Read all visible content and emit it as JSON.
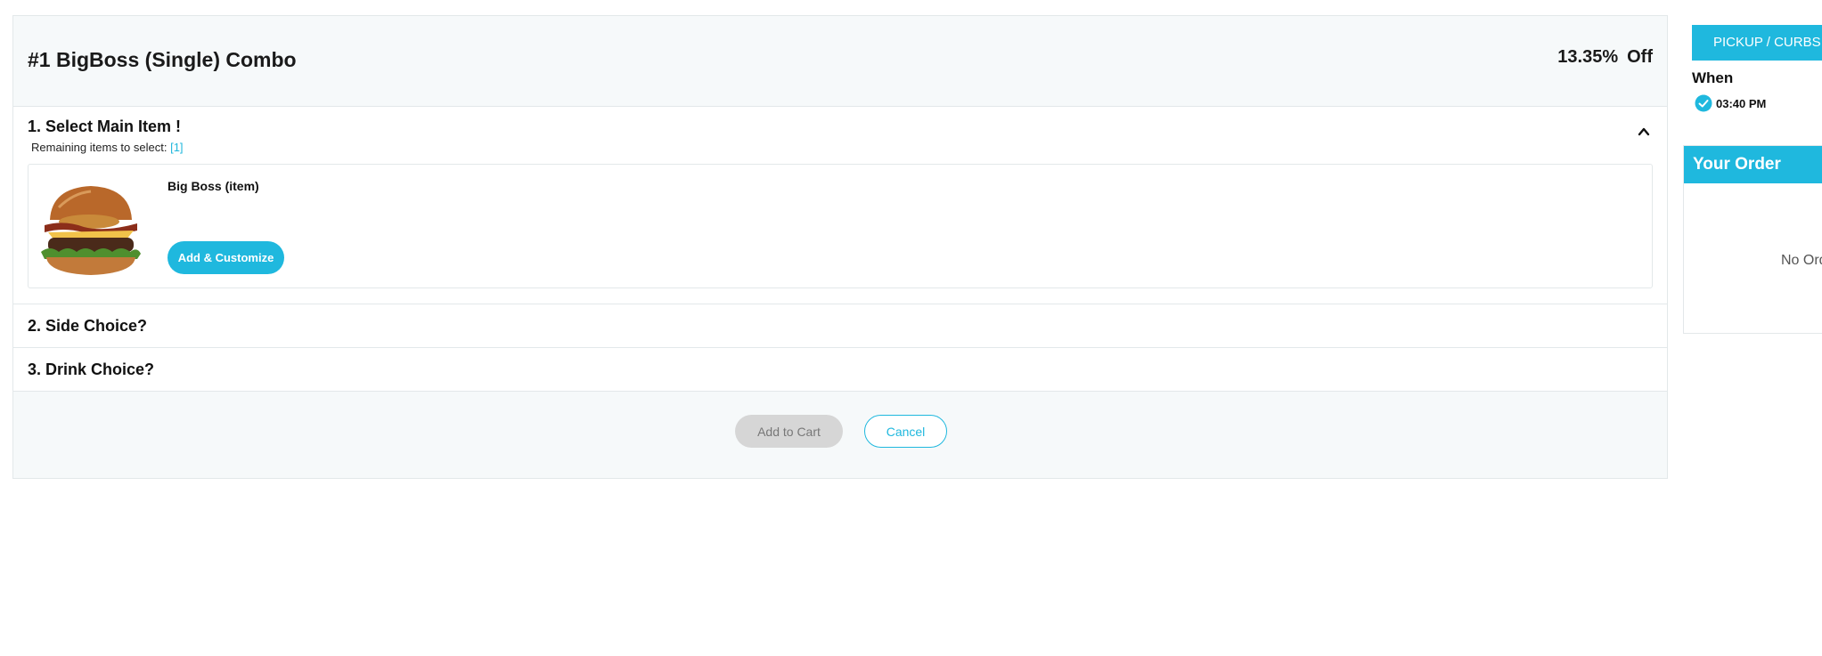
{
  "combo": {
    "title": "#1 BigBoss (Single) Combo",
    "discount_value": "13.35%",
    "discount_label": "Off"
  },
  "sections": [
    {
      "title": "1.  Select Main Item !",
      "remaining_label": "Remaining items to select:",
      "remaining_count": "[1]",
      "items": [
        {
          "name": "Big Boss (item)",
          "button_label": "Add & Customize",
          "image_icon": "burger-image"
        }
      ]
    },
    {
      "title": "2.  Side Choice?"
    },
    {
      "title": "3.  Drink Choice?"
    }
  ],
  "actions": {
    "add_to_cart": "Add to Cart",
    "cancel": "Cancel"
  },
  "sidebar": {
    "pickup_label": "PICKUP / CURBSIDE",
    "when_label": "When",
    "when_time": "03:40 PM",
    "order_title": "Your Order",
    "order_empty": "No Orders"
  },
  "colors": {
    "accent": "#1fb8de",
    "panel_bg": "#f6f9fa",
    "disabled": "#d6d6d6"
  }
}
